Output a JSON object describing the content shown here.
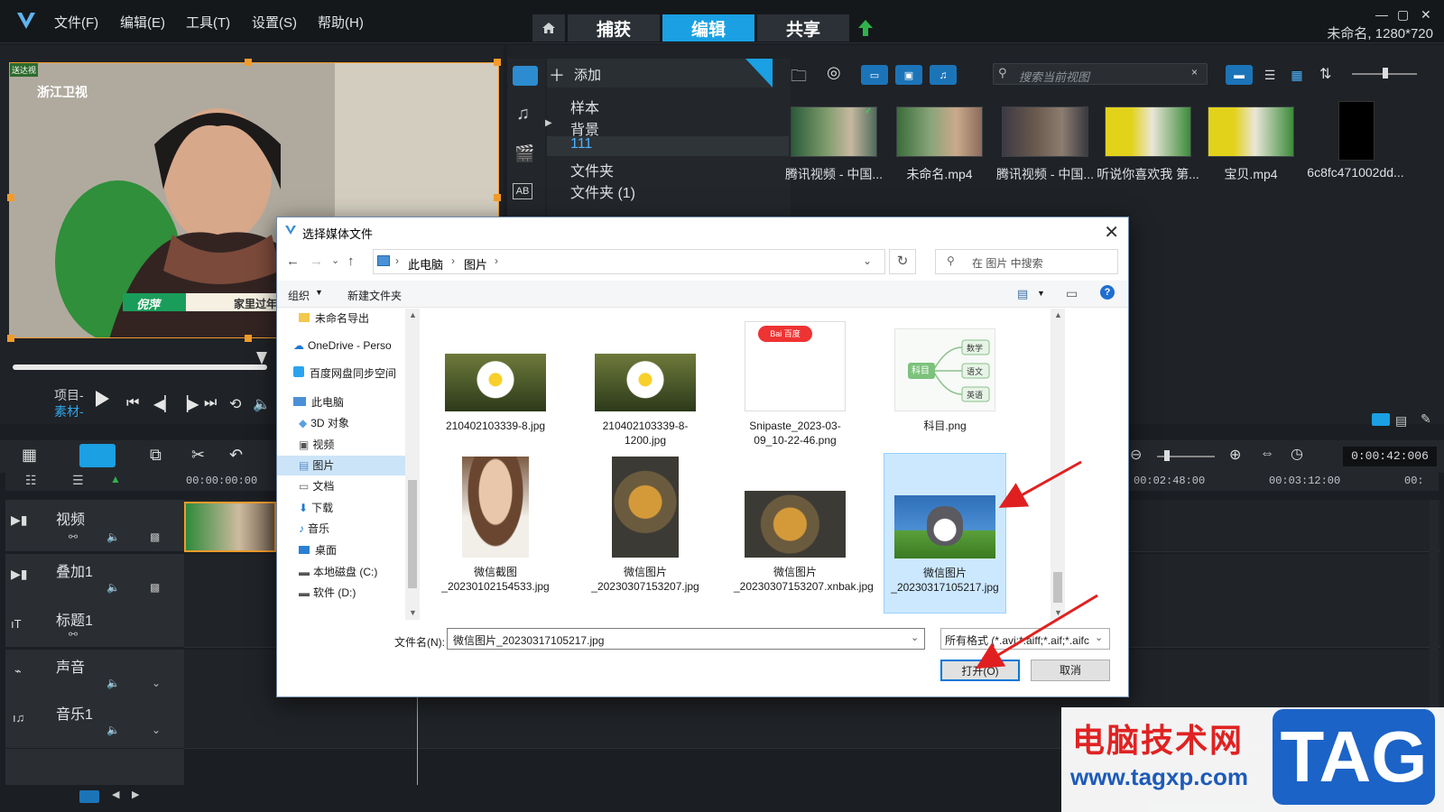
{
  "menu": {
    "file": "文件(F)",
    "edit": "编辑(E)",
    "tools": "工具(T)",
    "settings": "设置(S)",
    "help": "帮助(H)"
  },
  "mode_tabs": {
    "capture": "捕获",
    "edit": "编辑",
    "share": "共享"
  },
  "project_info": "未命名, 1280*720",
  "preview": {
    "channel_logo": "浙江卫视",
    "name_tag": "倪萍",
    "caption_tail": "家里过年",
    "corner_tag": "送达视",
    "project_label": "项目-",
    "clip_label": "素材-"
  },
  "library": {
    "add_label": "添加",
    "tree": [
      "样本",
      "背景",
      "111",
      "文件夹",
      "文件夹 (1)"
    ],
    "search_placeholder": "搜索当前视图",
    "thumbnails": [
      "腾讯视频 - 中国...",
      "未命名.mp4",
      "腾讯视频 - 中国...",
      "听说你喜欢我 第...",
      "宝贝.mp4",
      "6c8fc471002dd..."
    ]
  },
  "timeline": {
    "timecode": "0:00:42:006",
    "ruler": [
      "00:00:00:00",
      "00:02:48:00",
      "00:03:12:00",
      "00:"
    ],
    "tracks": [
      "视频",
      "叠加1",
      "标题1",
      "声音",
      "音乐1"
    ]
  },
  "dialog": {
    "title": "选择媒体文件",
    "breadcrumb": [
      "此电脑",
      "图片"
    ],
    "search_placeholder": "在 图片 中搜索",
    "organize": "组织",
    "new_folder": "新建文件夹",
    "nav": [
      "未命名导出",
      "OneDrive - Perso",
      "百度网盘同步空间",
      "此电脑",
      "3D 对象",
      "视频",
      "图片",
      "文档",
      "下载",
      "音乐",
      "桌面",
      "本地磁盘 (C:)",
      "软件 (D:)"
    ],
    "files": [
      "210402103339-8.jpg",
      "210402103339-8-1200.jpg",
      "Snipaste_2023-03-09_10-22-46.png",
      "科目.png",
      "微信截图_20230102154533.jpg",
      "微信图片_20230307153207.jpg",
      "微信图片_20230307153207.xnbak.jpg",
      "微信图片_20230317105217.jpg"
    ],
    "mindmap": {
      "root": "科目",
      "branches": [
        "数学",
        "语文",
        "英语"
      ]
    },
    "baidu_logo": "Bai  百度",
    "filename_label": "文件名(N):",
    "filename_value": "微信图片_20230317105217.jpg",
    "filetype_value": "所有格式 (*.avi;*.aiff;*.aif;*.aifc",
    "open_button": "打开(O)",
    "cancel_button": "取消"
  },
  "watermark": {
    "cn": "电脑技术网",
    "url": "www.tagxp.com",
    "tag": "TAG"
  }
}
